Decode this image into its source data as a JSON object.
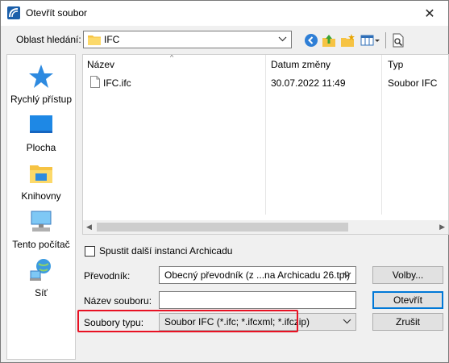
{
  "window": {
    "title": "Otevřít soubor",
    "close_glyph": "✕"
  },
  "lookin": {
    "label": "Oblast hledání:",
    "value": "IFC"
  },
  "toolbar": {
    "icons": [
      "back-icon",
      "up-folder-icon",
      "new-folder-icon",
      "view-menu-icon",
      "preview-icon"
    ]
  },
  "places": [
    {
      "label": "Rychlý přístup",
      "icon": "star-icon"
    },
    {
      "label": "Plocha",
      "icon": "desktop-icon"
    },
    {
      "label": "Knihovny",
      "icon": "libraries-icon"
    },
    {
      "label": "Tento počítač",
      "icon": "computer-icon"
    },
    {
      "label": "Síť",
      "icon": "network-icon"
    }
  ],
  "filelist": {
    "columns": [
      "Název",
      "Datum změny",
      "Typ"
    ],
    "rows": [
      {
        "name": "IFC.ifc",
        "date": "30.07.2022 11:49",
        "type": "Soubor IFC"
      }
    ]
  },
  "options": {
    "spustit_label": "Spustit další instanci Archicadu",
    "prevodnik_label": "Převodník:",
    "prevodnik_value": "Obecný převodník (z ...na Archicadu 26.tpl)",
    "nazev_label": "Název souboru:",
    "nazev_value": "",
    "typ_label": "Soubory typu:",
    "typ_value": "Soubor IFC (*.ifc; *.ifcxml; *.ifczip)"
  },
  "buttons": {
    "volby": "Volby...",
    "otevrit": "Otevřít",
    "zrusit": "Zrušit"
  },
  "colors": {
    "highlight": "#e81123",
    "focus": "#0078d7",
    "folder": "#f6c343"
  }
}
